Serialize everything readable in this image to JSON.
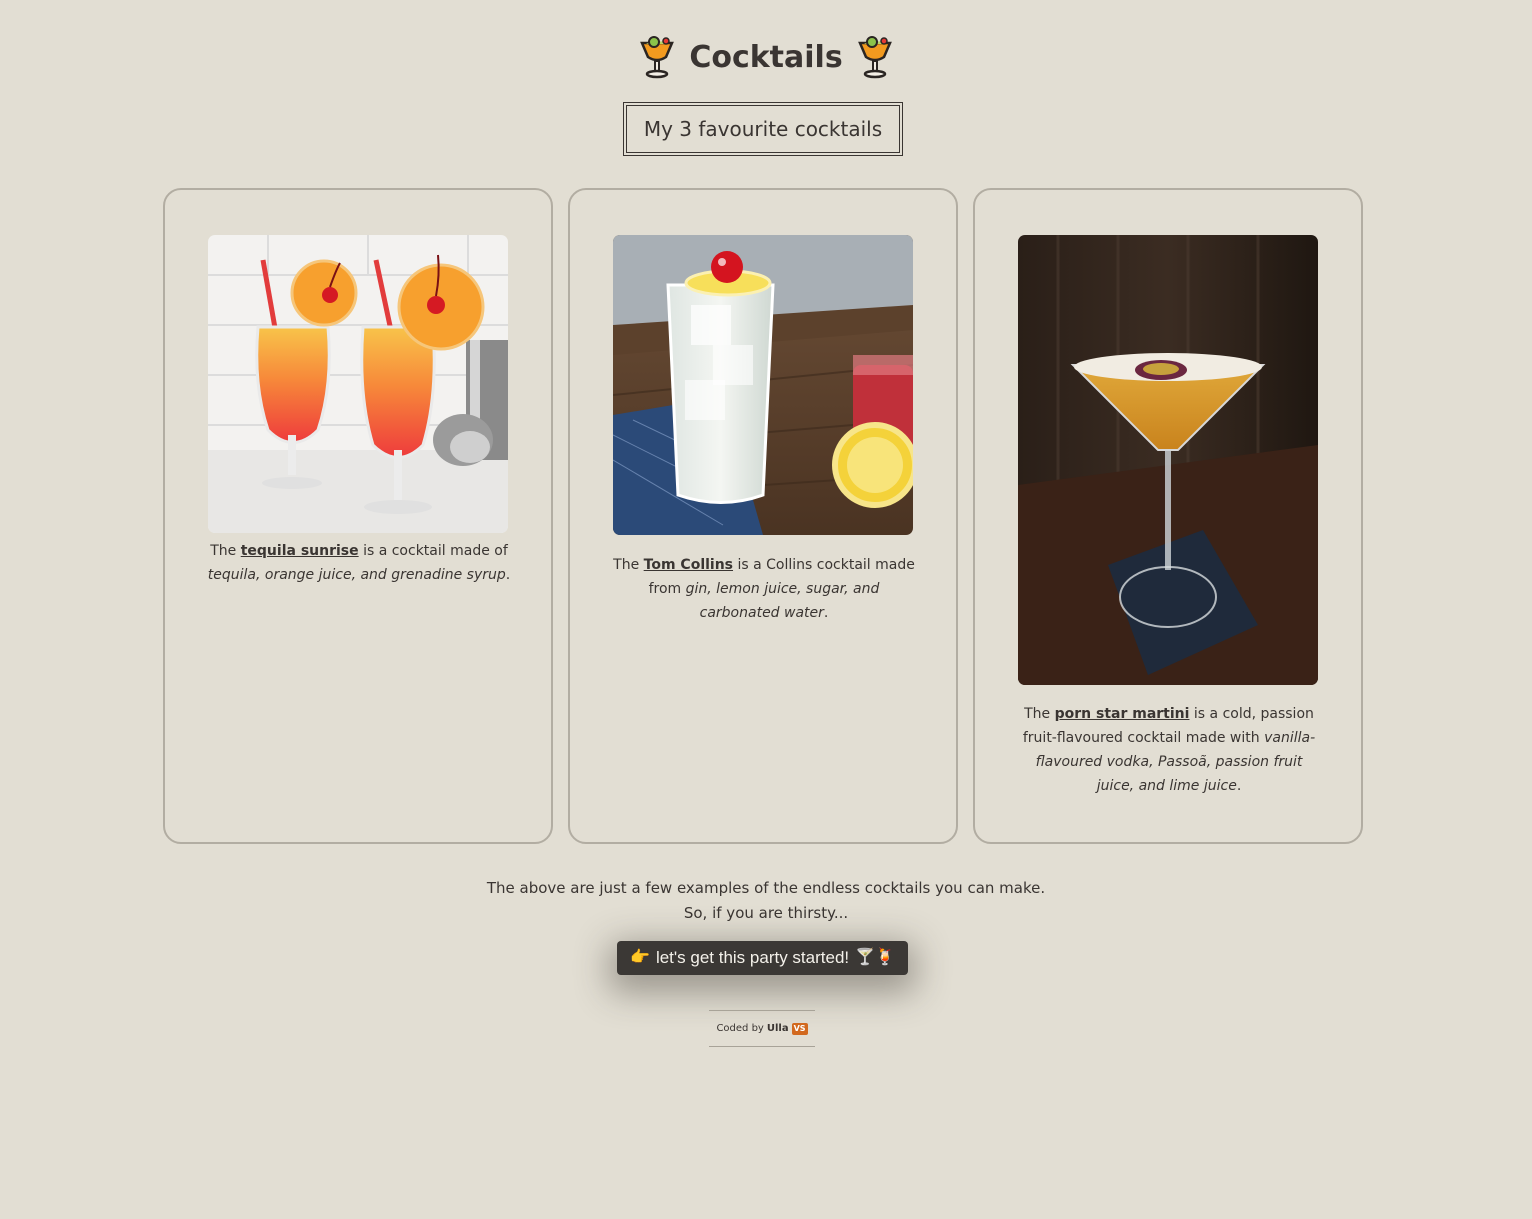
{
  "header": {
    "title": "Cocktails",
    "subtitle": "My 3 favourite cocktails"
  },
  "cards": [
    {
      "pre": "The ",
      "link": "tequila sunrise",
      "mid": " is a cocktail made of ",
      "ingredients": "tequila, orange juice, and grenadine syrup",
      "end": "."
    },
    {
      "pre": "The ",
      "link": "Tom Collins",
      "mid": " is a Collins cocktail made from ",
      "ingredients": "gin, lemon juice, sugar, and carbonated water",
      "end": "."
    },
    {
      "pre": "The ",
      "link": "porn star martini",
      "mid": " is a cold, passion fruit-flavoured cocktail made with ",
      "ingredients": "vanilla-flavoured vodka, Passoã, passion fruit juice, and lime juice",
      "end": "."
    }
  ],
  "footer": {
    "line1": "The above are just a few examples of the endless cocktails you can make.",
    "line2": "So, if you are thirsty...",
    "cta_pointer": "👉",
    "cta_label": "let's get this party started!",
    "cta_icons": "🍸🍹",
    "credit_prefix": "Coded by",
    "credit_name": "Ulla",
    "credit_badge": "VS"
  },
  "colors": {
    "background": "#e2ded3",
    "text": "#3a3532",
    "card_border": "#b2ada2",
    "button": "#3b3835"
  }
}
